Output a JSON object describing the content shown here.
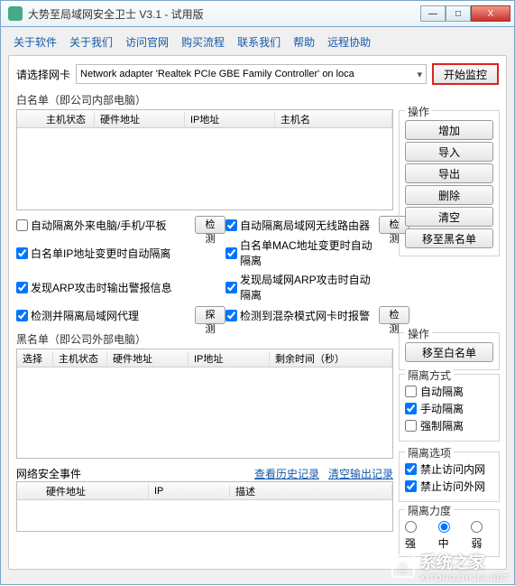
{
  "window": {
    "title": "大势至局域网安全卫士 V3.1 - 试用版",
    "min": "—",
    "max": "□",
    "close": "X"
  },
  "menu": [
    "关于软件",
    "关于我们",
    "访问官网",
    "购买流程",
    "联系我们",
    "帮助",
    "远程协助"
  ],
  "nic": {
    "label": "请选择网卡",
    "value": "Network adapter 'Realtek PCIe GBE Family Controller' on loca",
    "start": "开始监控"
  },
  "whitelist": {
    "title": "白名单（即公司内部电脑）",
    "cols": [
      "",
      "主机状态",
      "硬件地址",
      "IP地址",
      "主机名"
    ]
  },
  "ops1": {
    "legend": "操作",
    "buttons": [
      "增加",
      "导入",
      "导出",
      "删除",
      "清空",
      "移至黑名单"
    ]
  },
  "checks": {
    "c1": "自动隔离外来电脑/手机/平板",
    "b1": "检测",
    "c2": "自动隔离局域网无线路由器",
    "b2": "检测",
    "c3": "白名单IP地址变更时自动隔离",
    "c4": "白名单MAC地址变更时自动隔离",
    "c5": "发现ARP攻击时输出警报信息",
    "c6": "发现局域网ARP攻击时自动隔离",
    "c7": "检测并隔离局域网代理",
    "b7": "探测",
    "c8": "检测到混杂模式网卡时报警",
    "b8": "检测"
  },
  "blacklist": {
    "title": "黑名单（即公司外部电脑）",
    "cols": [
      "选择",
      "主机状态",
      "硬件地址",
      "IP地址",
      "剩余时间（秒）"
    ]
  },
  "ops2": {
    "legend": "操作",
    "btn": "移至白名单"
  },
  "mode": {
    "legend": "隔离方式",
    "o1": "自动隔离",
    "o2": "手动隔离",
    "o3": "强制隔离"
  },
  "opts": {
    "legend": "隔离选项",
    "o1": "禁止访问内网",
    "o2": "禁止访问外网"
  },
  "level": {
    "legend": "隔离力度",
    "r1": "强",
    "r2": "中",
    "r3": "弱"
  },
  "events": {
    "title": "网络安全事件",
    "link1": "查看历史记录",
    "link2": "清空输出记录",
    "cols": [
      "",
      "硬件地址",
      "IP",
      "描述"
    ]
  },
  "watermark": {
    "text": "系统之家",
    "sub": "XITONGZHIJIA.NET"
  }
}
